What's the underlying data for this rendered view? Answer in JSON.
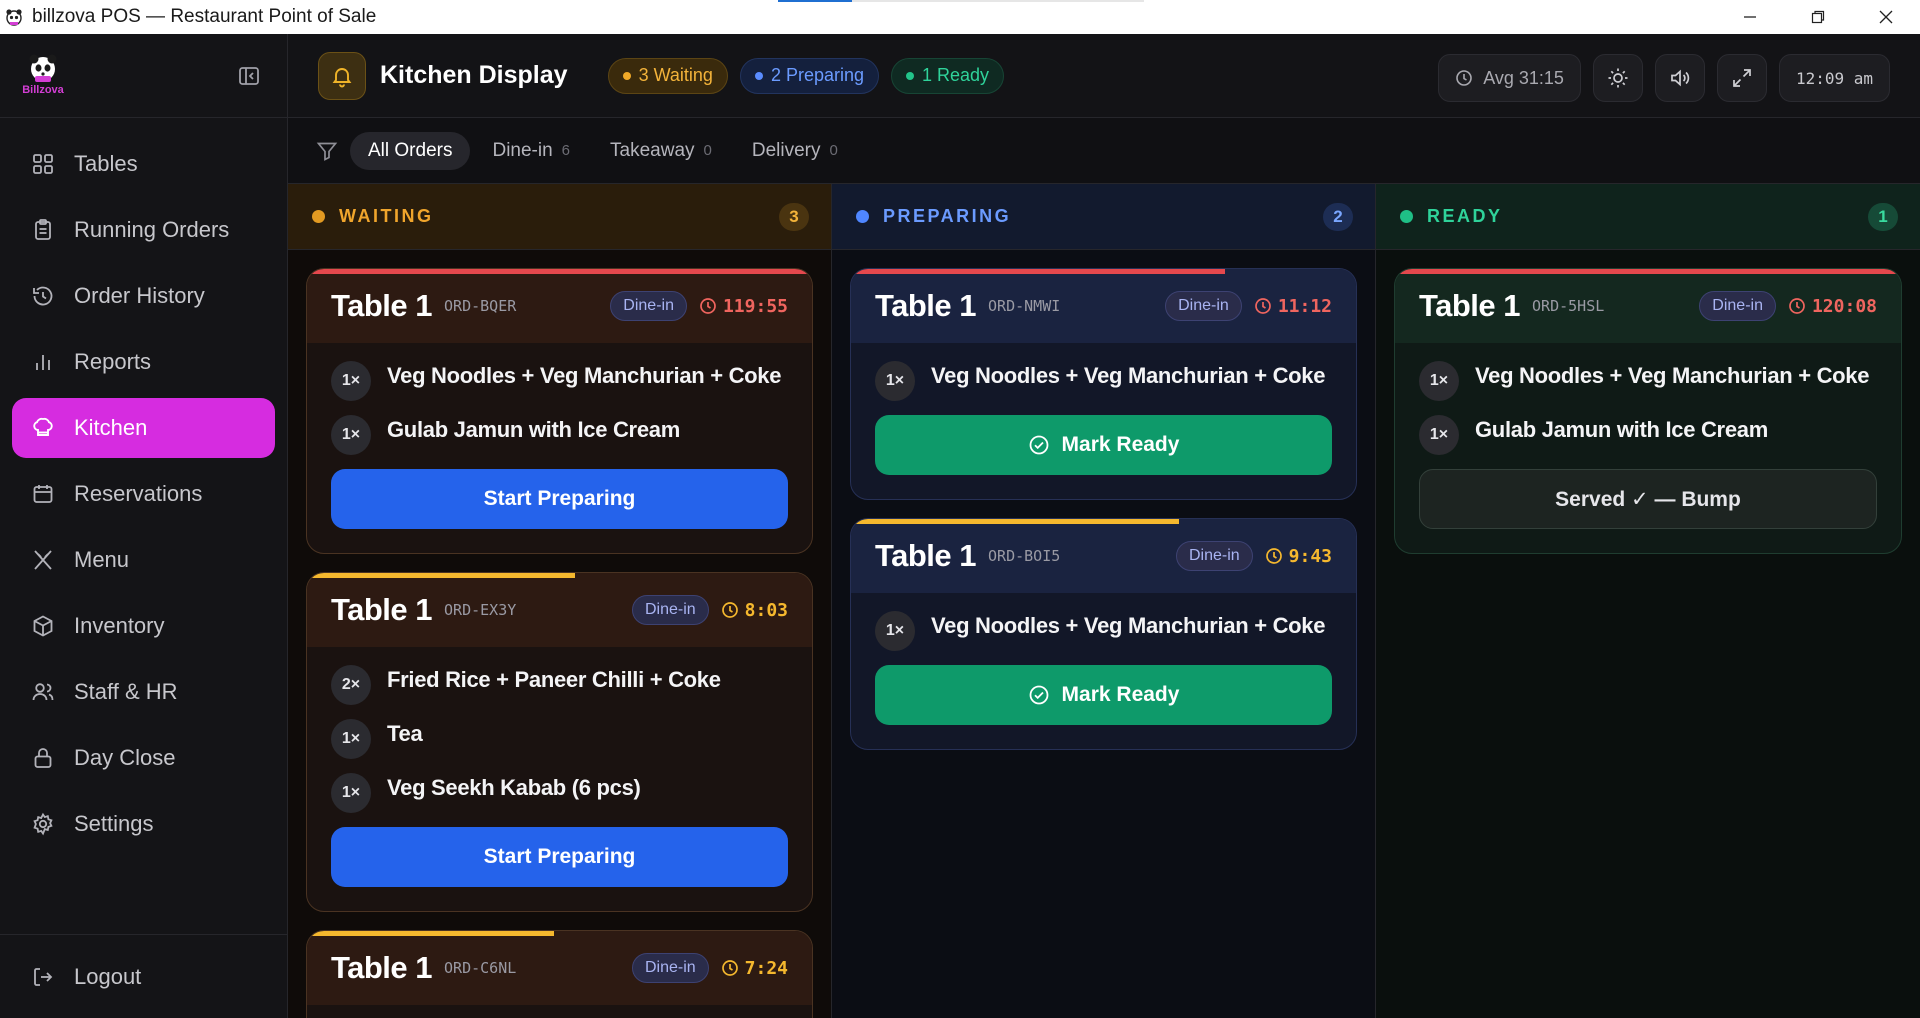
{
  "window": {
    "title": "billzova POS — Restaurant Point of Sale"
  },
  "sidebar": {
    "logo_text": "Billzova",
    "items": [
      {
        "label": "Tables",
        "icon": "grid-icon"
      },
      {
        "label": "Running Orders",
        "icon": "clipboard-icon"
      },
      {
        "label": "Order History",
        "icon": "history-icon"
      },
      {
        "label": "Reports",
        "icon": "bar-chart-icon"
      },
      {
        "label": "Kitchen",
        "icon": "chef-hat-icon",
        "active": true
      },
      {
        "label": "Reservations",
        "icon": "calendar-icon"
      },
      {
        "label": "Menu",
        "icon": "utensils-icon"
      },
      {
        "label": "Inventory",
        "icon": "box-icon"
      },
      {
        "label": "Staff & HR",
        "icon": "users-icon"
      },
      {
        "label": "Day Close",
        "icon": "lock-icon"
      },
      {
        "label": "Settings",
        "icon": "gear-icon"
      }
    ],
    "logout": "Logout"
  },
  "header": {
    "title": "Kitchen Display",
    "pills": {
      "waiting": "3 Waiting",
      "preparing": "2 Preparing",
      "ready": "1 Ready"
    },
    "avg": "Avg 31:15",
    "clock": "12:09 am"
  },
  "filters": [
    {
      "label": "All Orders",
      "count": "",
      "active": true
    },
    {
      "label": "Dine-in",
      "count": "6"
    },
    {
      "label": "Takeaway",
      "count": "0"
    },
    {
      "label": "Delivery",
      "count": "0"
    }
  ],
  "columns": {
    "waiting": {
      "title": "WAITING",
      "count": "3",
      "cards": [
        {
          "table": "Table 1",
          "order_id": "ORD-BQER",
          "type": "Dine-in",
          "timer": "119:55",
          "timer_color": "red",
          "progress": 1.0,
          "progress_color": "red",
          "items": [
            {
              "qty": "1×",
              "name": "Veg Noodles + Veg Manchurian + Coke"
            },
            {
              "qty": "1×",
              "name": "Gulab Jamun with Ice Cream"
            }
          ],
          "action": "Start Preparing"
        },
        {
          "table": "Table 1",
          "order_id": "ORD-EX3Y",
          "type": "Dine-in",
          "timer": "8:03",
          "timer_color": "amber",
          "progress": 0.53,
          "progress_color": "amber",
          "items": [
            {
              "qty": "2×",
              "name": "Fried Rice + Paneer Chilli + Coke"
            },
            {
              "qty": "1×",
              "name": "Tea"
            },
            {
              "qty": "1×",
              "name": "Veg Seekh Kabab (6 pcs)"
            }
          ],
          "action": "Start Preparing"
        },
        {
          "table": "Table 1",
          "order_id": "ORD-C6NL",
          "type": "Dine-in",
          "timer": "7:24",
          "timer_color": "amber",
          "progress": 0.49,
          "progress_color": "amber",
          "items": [],
          "action": ""
        }
      ]
    },
    "preparing": {
      "title": "PREPARING",
      "count": "2",
      "cards": [
        {
          "table": "Table 1",
          "order_id": "ORD-NMWI",
          "type": "Dine-in",
          "timer": "11:12",
          "timer_color": "red",
          "progress": 0.74,
          "progress_color": "red",
          "items": [
            {
              "qty": "1×",
              "name": "Veg Noodles + Veg Manchurian + Coke"
            }
          ],
          "action": "Mark Ready"
        },
        {
          "table": "Table 1",
          "order_id": "ORD-BOI5",
          "type": "Dine-in",
          "timer": "9:43",
          "timer_color": "amber",
          "progress": 0.65,
          "progress_color": "amber",
          "items": [
            {
              "qty": "1×",
              "name": "Veg Noodles + Veg Manchurian + Coke"
            }
          ],
          "action": "Mark Ready"
        }
      ]
    },
    "ready": {
      "title": "READY",
      "count": "1",
      "cards": [
        {
          "table": "Table 1",
          "order_id": "ORD-5HSL",
          "type": "Dine-in",
          "timer": "120:08",
          "timer_color": "red",
          "progress": 1.0,
          "progress_color": "red",
          "items": [
            {
              "qty": "1×",
              "name": "Veg Noodles + Veg Manchurian + Coke"
            },
            {
              "qty": "1×",
              "name": "Gulab Jamun with Ice Cream"
            }
          ],
          "action": "Served ✓ — Bump"
        }
      ]
    }
  }
}
